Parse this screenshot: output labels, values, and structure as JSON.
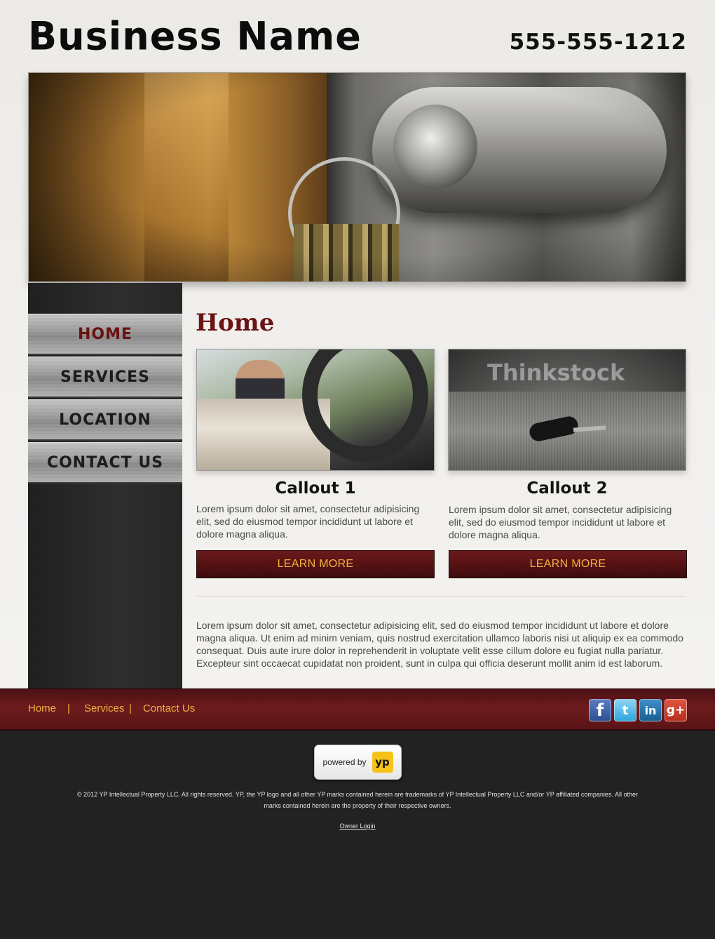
{
  "header": {
    "business_name": "Business Name",
    "phone": "555-555-1212"
  },
  "nav": {
    "items": [
      {
        "label": "HOME",
        "active": true
      },
      {
        "label": "SERVICES",
        "active": false
      },
      {
        "label": "LOCATION",
        "active": false
      },
      {
        "label": "CONTACT US",
        "active": false
      }
    ]
  },
  "main": {
    "title": "Home",
    "callouts": [
      {
        "title": "Callout 1",
        "text": "Lorem ipsum dolor sit amet, consectetur adipisicing elit, sed do eiusmod tempor incididunt ut labore et dolore magna aliqua.",
        "button": "LEARN MORE"
      },
      {
        "title": "Callout 2",
        "text": "Lorem ipsum dolor sit amet, consectetur adipisicing elit, sed do eiusmod tempor incididunt ut labore et dolore magna aliqua.",
        "button": "LEARN MORE",
        "image_watermark": "Thinkstock"
      }
    ],
    "body_text": "Lorem ipsum dolor sit amet, consectetur adipisicing elit, sed do eiusmod tempor incididunt ut labore et dolore magna aliqua. Ut enim ad minim veniam, quis nostrud exercitation ullamco laboris nisi ut aliquip ex ea commodo consequat. Duis aute irure dolor in reprehenderit in voluptate velit esse cillum dolore eu fugiat nulla pariatur. Excepteur sint occaecat cupidatat non proident, sunt in culpa qui officia deserunt mollit anim id est laborum."
  },
  "footer": {
    "links": [
      "Home",
      "Services",
      "Contact Us"
    ],
    "separator": "|",
    "social_icons": [
      "facebook-icon",
      "twitter-icon",
      "linkedin-icon",
      "google-plus-icon"
    ],
    "social_glyphs": {
      "facebook": "f",
      "twitter": "t",
      "linkedin": "in",
      "google_plus": "g+"
    },
    "badge": {
      "text": "powered by",
      "logo": "yp"
    },
    "copyright": "© 2012  YP Intellectual Property LLC. All rights reserved. YP, the YP logo and all other YP marks contained herein are trademarks of YP Intellectual Property LLC and/or YP affiliated companies. All other marks contained herein are the property of their respective owners.",
    "owner_login": "Owner Login"
  },
  "colors": {
    "accent_maroon": "#6a1414",
    "link_gold": "#f0b33d",
    "footer_dark": "#222222"
  }
}
